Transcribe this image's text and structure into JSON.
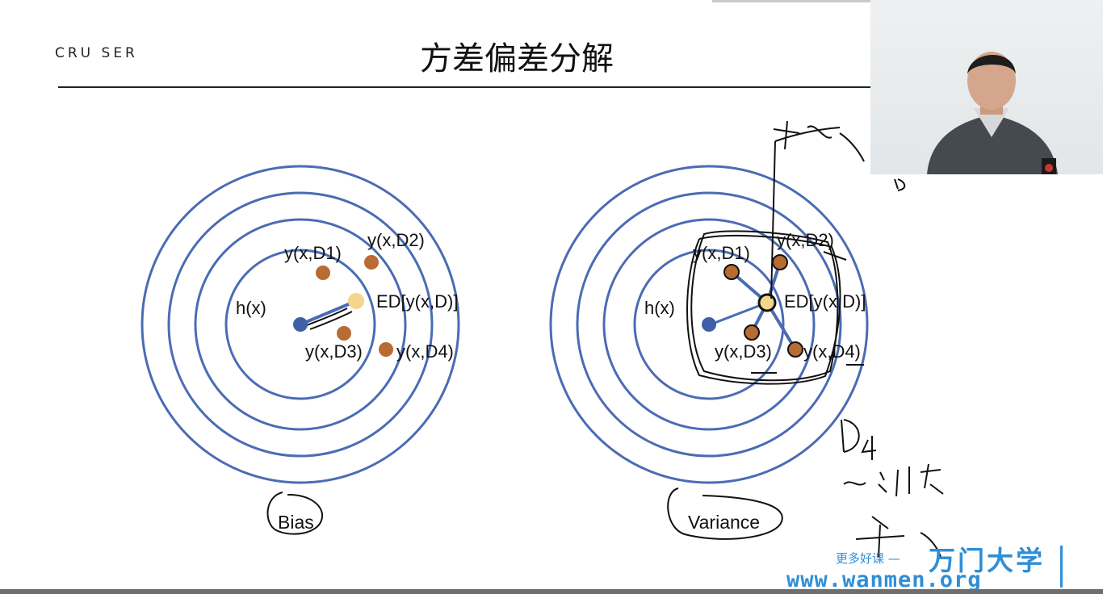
{
  "logo": "CRU SER",
  "title": "方差偏差分解",
  "bias": {
    "center_label": "h(x)",
    "expected_label": "ED[y(x,D)]",
    "samples": [
      "y(x,D1)",
      "y(x,D2)",
      "y(x,D3)",
      "y(x,D4)"
    ],
    "caption": "Bias"
  },
  "variance": {
    "center_label": "h(x)",
    "expected_label": "ED[y(x,D)]",
    "samples": [
      "y(x,D1)",
      "y(x,D2)",
      "y(x,D3)",
      "y(x,D4)"
    ],
    "caption": "Variance"
  },
  "colors": {
    "rings": "#4a6cb5",
    "center": "#3f5fa6",
    "sample": "#b86b32",
    "expected": "#f3d58c",
    "ink": "#111111",
    "watermark": "#2f8fd6"
  },
  "watermark": {
    "small": "更多好课 —",
    "big": "万门大学",
    "url": "www.wanmen.org"
  }
}
